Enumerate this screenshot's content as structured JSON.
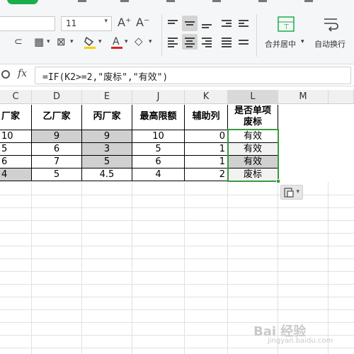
{
  "ribbon": {
    "font_size": "11",
    "font_size_dd": "▾",
    "increase_font": "A⁺",
    "decrease_font": "A⁻",
    "merge_center_label": "合并居中",
    "merge_dd": "▾",
    "auto_wrap_label": "自动换行",
    "colors": {
      "font_color": "#e02020",
      "fill_color": "#f5d000",
      "accent_green": "#1aad4b"
    }
  },
  "formula_bar": {
    "fx_label": "fx",
    "formula": "=IF(K2>=2,\"废标\",\"有效\")"
  },
  "columns": [
    "C",
    "D",
    "E",
    "J",
    "K",
    "L",
    "M"
  ],
  "table": {
    "headers": {
      "c": "厂家",
      "d": "乙厂家",
      "e": "丙厂家",
      "j": "最高限额",
      "k": "辅助列",
      "l_line1": "是否单项",
      "l_line2": "废标"
    },
    "rows": [
      {
        "c": "10",
        "d": "9",
        "e": "9",
        "j": "10",
        "k": "0",
        "l": "有效"
      },
      {
        "c": "5",
        "d": "6",
        "e": "3",
        "j": "5",
        "k": "1",
        "l": "有效"
      },
      {
        "c": "6",
        "d": "7",
        "e": "5",
        "j": "6",
        "k": "1",
        "l": "有效"
      },
      {
        "c": "4",
        "d": "5",
        "e": "4.5",
        "j": "4",
        "k": "2",
        "l": "废标"
      }
    ]
  },
  "smart_tag": {
    "icon": "paste-options-icon",
    "dd": "▾"
  },
  "watermark": {
    "text": "Bai 经验",
    "sub": "jingyan.baidu.com"
  }
}
